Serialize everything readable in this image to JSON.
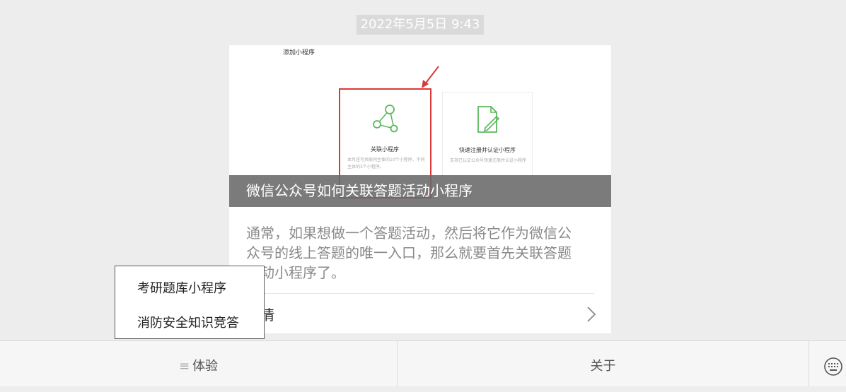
{
  "chat": {
    "timestamp": "2022年5月5日  9:43"
  },
  "article_card": {
    "cover": {
      "heading": "添加小程序",
      "option_related": {
        "title": "关联小程序",
        "desc": "本月还可关联同主体的10个小程序，不同主体的3个小程序。"
      },
      "option_quick": {
        "title": "快速注册并认证小程序",
        "desc": "支持已认证公众号快速注册并认证小程序"
      },
      "highlight_color": "#d73a3a",
      "icon_color": "#5cb85c"
    },
    "title": "微信公众号如何关联答题活动小程序",
    "summary": "通常，如果想做一个答题活动，然后将它作为微信公众号的线上答题的唯一入口，那么就要首先关联答题活动小程序了。",
    "details_label": "详情"
  },
  "popup_menu": {
    "items": [
      "考研题库小程序",
      "消防安全知识竞答"
    ]
  },
  "bottom_bar": {
    "tab_experience": "体验",
    "tab_about": "关于",
    "menu_glyph": "≡",
    "keyboard_icon": "keyboard-icon"
  }
}
